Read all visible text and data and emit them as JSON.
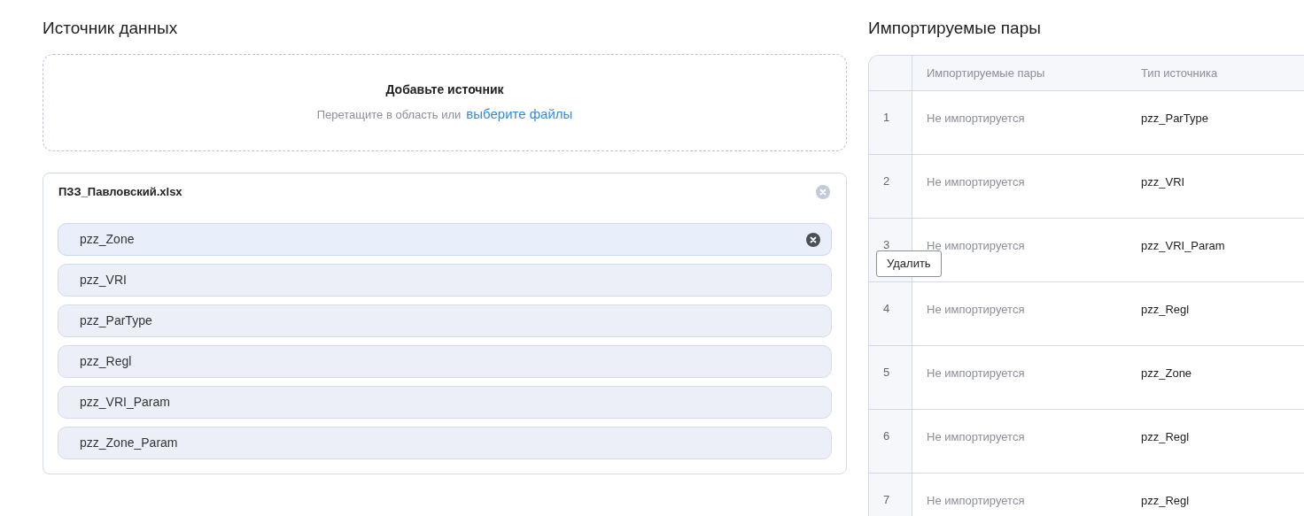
{
  "source": {
    "title": "Источник данных",
    "dropzone": {
      "title": "Добавьте источник",
      "hint": "Перетащите в область или",
      "link": "выберите файлы"
    },
    "file": {
      "name": "ПЗЗ_Павловский.xlsx",
      "sheets": [
        {
          "name": "pzz_Zone",
          "hovered": true
        },
        {
          "name": "pzz_VRI",
          "hovered": false
        },
        {
          "name": "pzz_ParType",
          "hovered": false
        },
        {
          "name": "pzz_Regl",
          "hovered": false
        },
        {
          "name": "pzz_VRI_Param",
          "hovered": false
        },
        {
          "name": "pzz_Zone_Param",
          "hovered": false
        }
      ]
    },
    "tooltip": "Удалить"
  },
  "pairs": {
    "title": "Импортируемые пары",
    "table": {
      "columns": [
        "Импортируемые пары",
        "Тип источника"
      ],
      "rows": [
        {
          "number": "1",
          "pair": "Не импортируется",
          "source_type": "pzz_ParType"
        },
        {
          "number": "2",
          "pair": "Не импортируется",
          "source_type": "pzz_VRI"
        },
        {
          "number": "3",
          "pair": "Не импортируется",
          "source_type": "pzz_VRI_Param"
        },
        {
          "number": "4",
          "pair": "Не импортируется",
          "source_type": "pzz_Regl"
        },
        {
          "number": "5",
          "pair": "Не импортируется",
          "source_type": "pzz_Zone"
        },
        {
          "number": "6",
          "pair": "Не импортируется",
          "source_type": "pzz_Regl"
        },
        {
          "number": "7",
          "pair": "Не импортируется",
          "source_type": "pzz_Regl"
        }
      ]
    }
  }
}
